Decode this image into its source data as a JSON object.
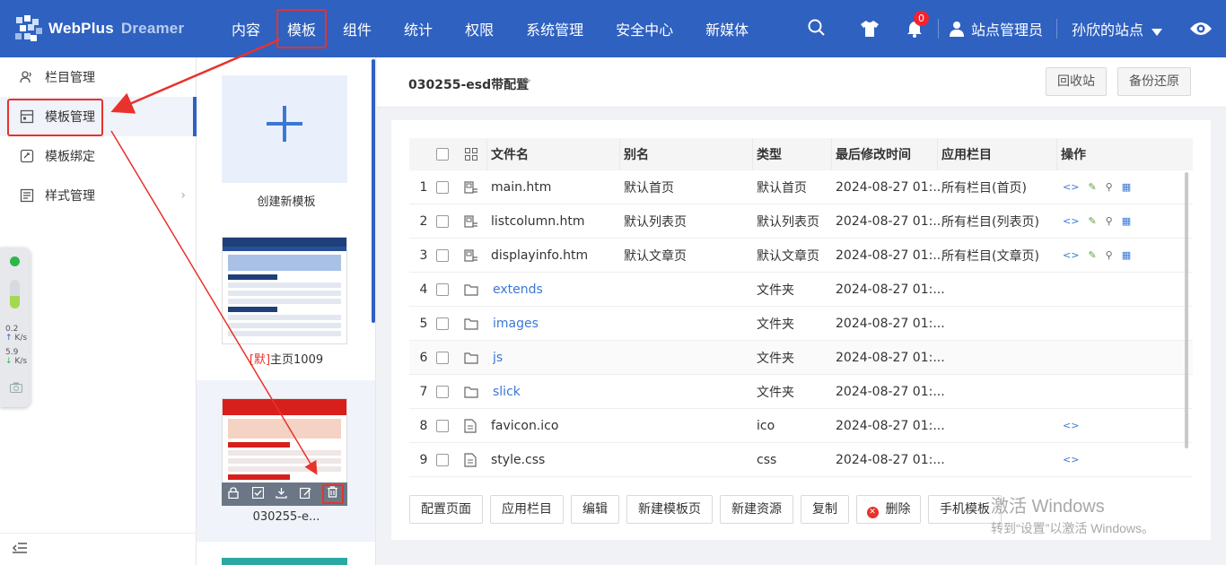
{
  "brand": {
    "name": "WebPlus",
    "sub": "Dreamer"
  },
  "nav": [
    "内容",
    "模板",
    "组件",
    "统计",
    "权限",
    "系统管理",
    "安全中心",
    "新媒体"
  ],
  "nav_active": "模板",
  "top_right": {
    "notifications": "0",
    "user": "站点管理员",
    "site": "孙欣的站点"
  },
  "sidebar": {
    "items": [
      {
        "label": "栏目管理",
        "icon": "users-icon"
      },
      {
        "label": "模板管理",
        "icon": "template-icon"
      },
      {
        "label": "模板绑定",
        "icon": "bind-icon"
      },
      {
        "label": "样式管理",
        "icon": "style-icon"
      }
    ],
    "active": "模板管理"
  },
  "monitor": {
    "up": "0.2",
    "down": "5.9",
    "unit": "K/s",
    "level": 0.45
  },
  "templates": {
    "new_label": "创建新模板",
    "items": [
      {
        "prefix": "[默]",
        "name": "主页1009"
      },
      {
        "name": "030255-e..."
      }
    ]
  },
  "main": {
    "title": "030255-esd带配置",
    "recycle": "回收站",
    "backup": "备份还原",
    "columns": [
      "文件名",
      "别名",
      "类型",
      "最后修改时间",
      "应用栏目",
      "操作"
    ],
    "rows": [
      {
        "n": "1",
        "name": "main.htm",
        "alias": "默认首页",
        "type": "默认首页",
        "time": "2024-08-27 01:...",
        "col": "所有栏目(首页)",
        "kind": "page"
      },
      {
        "n": "2",
        "name": "listcolumn.htm",
        "alias": "默认列表页",
        "type": "默认列表页",
        "time": "2024-08-27 01:...",
        "col": "所有栏目(列表页)",
        "kind": "page"
      },
      {
        "n": "3",
        "name": "displayinfo.htm",
        "alias": "默认文章页",
        "type": "默认文章页",
        "time": "2024-08-27 01:...",
        "col": "所有栏目(文章页)",
        "kind": "page"
      },
      {
        "n": "4",
        "name": "extends",
        "alias": "",
        "type": "文件夹",
        "time": "2024-08-27 01:...",
        "col": "",
        "kind": "folder"
      },
      {
        "n": "5",
        "name": "images",
        "alias": "",
        "type": "文件夹",
        "time": "2024-08-27 01:...",
        "col": "",
        "kind": "folder"
      },
      {
        "n": "6",
        "name": "js",
        "alias": "",
        "type": "文件夹",
        "time": "2024-08-27 01:...",
        "col": "",
        "kind": "folder"
      },
      {
        "n": "7",
        "name": "slick",
        "alias": "",
        "type": "文件夹",
        "time": "2024-08-27 01:...",
        "col": "",
        "kind": "folder"
      },
      {
        "n": "8",
        "name": "favicon.ico",
        "alias": "",
        "type": "ico",
        "time": "2024-08-27 01:...",
        "col": "",
        "kind": "file"
      },
      {
        "n": "9",
        "name": "style.css",
        "alias": "",
        "type": "css",
        "time": "2024-08-27 01:...",
        "col": "",
        "kind": "file"
      }
    ],
    "buttons": [
      "配置页面",
      "应用栏目",
      "编辑",
      "新建模板页",
      "新建资源",
      "复制",
      "删除",
      "手机模板"
    ]
  },
  "watermark": {
    "line1": "激活 Windows",
    "line2": "转到“设置”以激活 Windows。"
  },
  "colors": {
    "topbar": "#2f61c0",
    "highlight": "#e8322c",
    "link": "#3b78d6"
  }
}
